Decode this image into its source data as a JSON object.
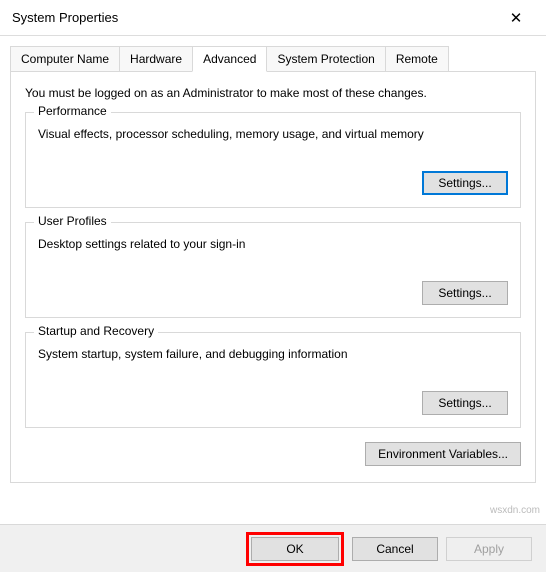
{
  "window": {
    "title": "System Properties"
  },
  "tabs": {
    "computer_name": "Computer Name",
    "hardware": "Hardware",
    "advanced": "Advanced",
    "system_protection": "System Protection",
    "remote": "Remote"
  },
  "advanced": {
    "intro": "You must be logged on as an Administrator to make most of these changes.",
    "performance": {
      "legend": "Performance",
      "desc": "Visual effects, processor scheduling, memory usage, and virtual memory",
      "settings": "Settings..."
    },
    "user_profiles": {
      "legend": "User Profiles",
      "desc": "Desktop settings related to your sign-in",
      "settings": "Settings..."
    },
    "startup_recovery": {
      "legend": "Startup and Recovery",
      "desc": "System startup, system failure, and debugging information",
      "settings": "Settings..."
    },
    "env_vars": "Environment Variables..."
  },
  "footer": {
    "ok": "OK",
    "cancel": "Cancel",
    "apply": "Apply"
  },
  "watermark": "wsxdn.com"
}
